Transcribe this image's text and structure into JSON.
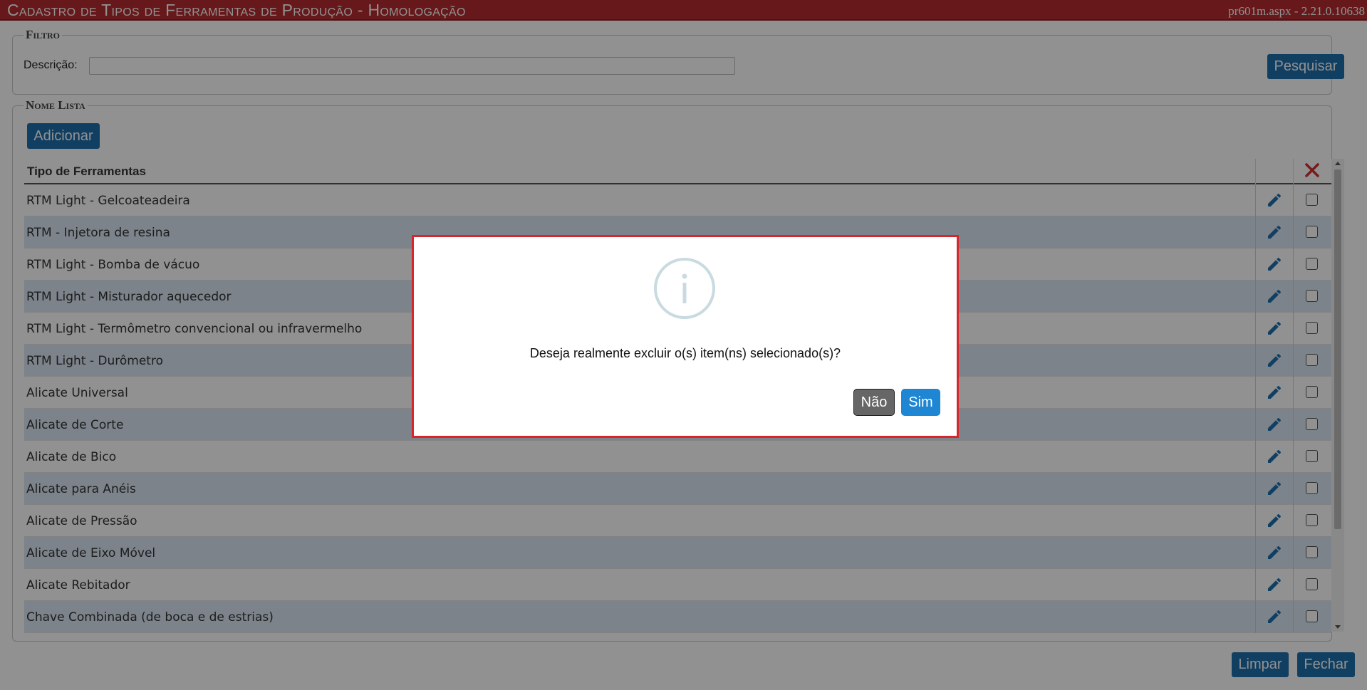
{
  "window": {
    "title": "Cadastro de Tipos de Ferramentas de Produção  - Homologação",
    "version": "pr601m.aspx - 2.21.0.10638"
  },
  "filter": {
    "legend": "Filtro",
    "description_label": "Descrição:",
    "description_value": "",
    "search_button": "Pesquisar"
  },
  "list": {
    "legend": "Nome Lista",
    "add_button": "Adicionar",
    "column_header": "Tipo de Ferramentas",
    "rows": [
      "RTM Light - Gelcoateadeira",
      "RTM - Injetora de resina",
      "RTM Light - Bomba de vácuo",
      "RTM Light - Misturador aquecedor",
      "RTM Light - Termômetro convencional ou infravermelho",
      "RTM Light - Durômetro",
      "Alicate Universal",
      "Alicate de Corte",
      "Alicate de Bico",
      "Alicate para Anéis",
      "Alicate de Pressão",
      "Alicate de Eixo Móvel",
      "Alicate Rebitador",
      "Chave Combinada (de boca e de estrias)"
    ]
  },
  "footer": {
    "clear_button": "Limpar",
    "close_button": "Fechar"
  },
  "dialog": {
    "message": "Deseja realmente excluir o(s) item(ns) selecionado(s)?",
    "no_button": "Não",
    "yes_button": "Sim",
    "icon": "info-icon"
  },
  "colors": {
    "titlebar": "#b52b2f",
    "primary_button": "#1f6fad",
    "row_alt": "#dae7f4",
    "dialog_border": "#d8262d",
    "delete_x": "#d32f2f"
  }
}
